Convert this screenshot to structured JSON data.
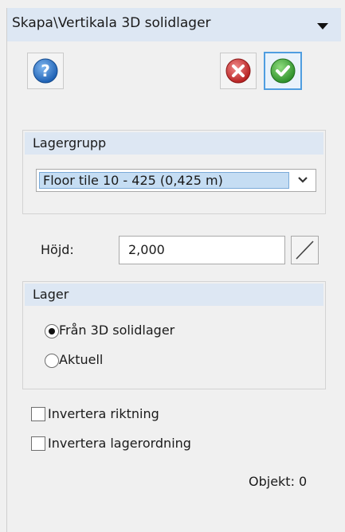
{
  "header": {
    "title": "Skapa\\Vertikala 3D solidlager"
  },
  "toolbar": {
    "help_icon": "help-icon",
    "cancel_icon": "cancel-icon",
    "ok_icon": "ok-icon"
  },
  "layer_group": {
    "heading": "Lagergrupp",
    "selected": "Floor tile 10 - 425 (0,425 m)"
  },
  "height": {
    "label": "Höjd:",
    "value": "2,000"
  },
  "layer": {
    "heading": "Lager",
    "options": [
      {
        "label": "Från 3D solidlager",
        "selected": true
      },
      {
        "label": "Aktuell",
        "selected": false
      }
    ]
  },
  "options": {
    "invert_direction": {
      "label": "Invertera riktning",
      "checked": false
    },
    "invert_layer_order": {
      "label": "Invertera lagerordning",
      "checked": false
    }
  },
  "status": {
    "objects": "Objekt: 0"
  },
  "colors": {
    "header_bg": "#dde7f3",
    "selection_bg": "#c5ddf3",
    "help_blue": "#2a73c9",
    "cancel_red": "#d63a3a",
    "ok_green": "#3fae3a"
  }
}
